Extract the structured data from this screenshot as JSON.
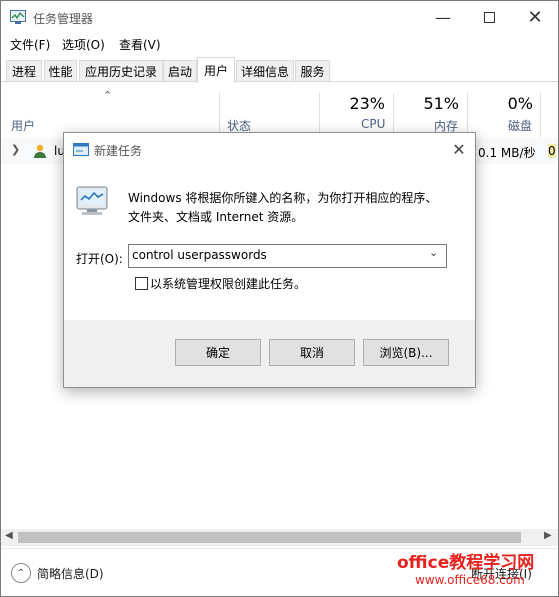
{
  "window": {
    "title": "任务管理器"
  },
  "menu": [
    "文件(F)",
    "选项(O)",
    "查看(V)"
  ],
  "tabs": [
    "进程",
    "性能",
    "应用历史记录",
    "启动",
    "用户",
    "详细信息",
    "服务"
  ],
  "active_tab": "用户",
  "columns": {
    "user": "用户",
    "status": "状态",
    "cpu": {
      "percent": "23%",
      "label": "CPU"
    },
    "memory": {
      "percent": "51%",
      "label": "内存"
    },
    "disk": {
      "percent": "0%",
      "label": "磁盘"
    }
  },
  "row": {
    "name_partial": "lu",
    "disk_value": "0.1 MB/秒",
    "extra": "0"
  },
  "footer": {
    "details_label": "简略信息(D)",
    "disconnect_label": "断开连接(I)"
  },
  "dialog": {
    "title": "新建任务",
    "message_line1": "Windows 将根据你所键入的名称，为你打开相应的程序、",
    "message_line2": "文件夹、文档或 Internet 资源。",
    "open_label": "打开(O):",
    "open_value": "control userpasswords",
    "admin_checkbox_label": "以系统管理权限创建此任务。",
    "admin_checked": false,
    "ok_label": "确定",
    "cancel_label": "取消",
    "browse_label": "浏览(B)..."
  },
  "watermark": {
    "line1": "office教程学习网",
    "line2": "www.office68.com"
  },
  "colors": {
    "accent_blue": "#0078d7",
    "watermark_red": "#e8231f",
    "footer_text": "#1a1a1a"
  }
}
